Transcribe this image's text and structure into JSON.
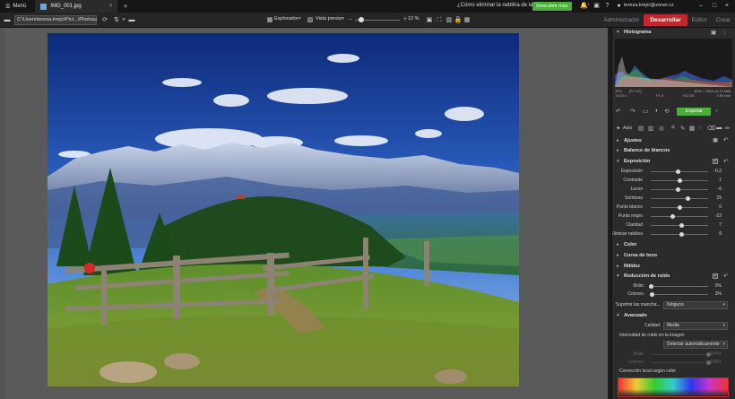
{
  "titlebar": {
    "menu_label": "Menú",
    "tab_label": "IMG_001.jpg",
    "promo_text": "¿Cómo eliminar la neblina de las f...",
    "discover_label": "Descubrir más",
    "notification_count": "1",
    "user_email": "tereza.krejci@zoner.cz"
  },
  "toolbar": {
    "path_value": "C:\\Users\\tereza.krejci\\Pict...\\Photos",
    "browser_label": "Explorador",
    "preview_label": "Vista previa",
    "zoom_value": "12 %",
    "zoom_fraction": 0.12,
    "modules": {
      "manager": "Administrador",
      "develop": "Desarrollar",
      "editor": "Editor",
      "create": "Crear"
    }
  },
  "panel": {
    "histogram_title": "Histograma",
    "histogram_info": {
      "line1_left": "JPG",
      "line1_mid": "[F/7.92]",
      "line1_right": "4032 × 3024 (0.13 MB)",
      "line2_left": "1/100 s",
      "line2_mid": "F1.8",
      "line2_mid2": "ISO 50",
      "line2_right": "3.99 mm"
    },
    "export_label": "Exportar",
    "auto_label": "Auto",
    "sections": {
      "adjustments": "Ajustes",
      "white_balance": "Balance de blancos",
      "exposure": "Exposición",
      "color": "Color",
      "tone_curve": "Curva de tono",
      "sharpness": "Nitidez",
      "noise_reduction": "Reducción de ruido",
      "advanced": "Avanzado"
    },
    "exposure_rows": [
      {
        "label": "Exposición",
        "value": "-0,2",
        "num": -0.2,
        "min": -5,
        "max": 5
      },
      {
        "label": "Contraste",
        "value": "1",
        "num": 1,
        "min": -100,
        "max": 100
      },
      {
        "label": "Luces",
        "value": "-6",
        "num": -6,
        "min": -100,
        "max": 100
      },
      {
        "label": "Sombras",
        "value": "29",
        "num": 29,
        "min": -100,
        "max": 100
      },
      {
        "label": "Punto blanco",
        "value": "0",
        "num": 0,
        "min": -100,
        "max": 100
      },
      {
        "label": "Punto negro",
        "value": "-22",
        "num": -22,
        "min": -100,
        "max": 100
      },
      {
        "label": "Claridad",
        "value": "7",
        "num": 7,
        "min": -100,
        "max": 100
      },
      {
        "label": "Eliminar neblina",
        "value": "8",
        "num": 8,
        "min": -100,
        "max": 100
      }
    ],
    "noise_rows": [
      {
        "label": "Brillo:",
        "value": "0%",
        "num": 0,
        "min": 0,
        "max": 100
      },
      {
        "label": "Colores:",
        "value": "3%",
        "num": 3,
        "min": 0,
        "max": 100
      }
    ],
    "suppress_label": "Suprimir las mancha...",
    "suppress_value": "Ninguno",
    "quality_label": "Calidad:",
    "quality_value": "Media",
    "noise_in_image_label": "Intensidad de ruido en la imagen",
    "detect_value": "Detectar automáticamente",
    "dim_rows": [
      {
        "label": "Brillo:",
        "value": "100%",
        "num": 100,
        "min": 0,
        "max": 100
      },
      {
        "label": "Colores:",
        "value": "100%",
        "num": 100,
        "min": 0,
        "max": 100
      }
    ],
    "local_correction_label": "Corrección local según color"
  },
  "icons": {
    "menu": "hamburger-icon",
    "folder": "folder-icon",
    "search": "search-icon",
    "refresh": "refresh-icon",
    "sort": "sort-icon",
    "notification": "bell-icon",
    "gift": "gift-icon",
    "help": "help-icon",
    "user": "user-icon"
  },
  "colors": {
    "accent_red": "#c0282d",
    "accent_green": "#4cae3a"
  }
}
